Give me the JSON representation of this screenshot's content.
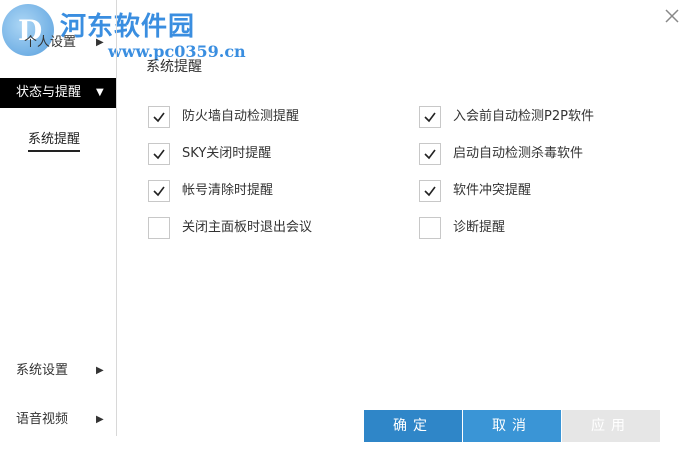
{
  "watermark": {
    "title": "河东软件园",
    "url": "www.pc0359.cn"
  },
  "sidebar": {
    "items": [
      {
        "label": "个人设置"
      },
      {
        "label": "状态与提醒"
      },
      {
        "label": "系统设置"
      },
      {
        "label": "语音视频"
      }
    ],
    "sub_items": [
      {
        "label": "系统提醒"
      }
    ]
  },
  "main": {
    "section_title": "系统提醒",
    "options_left": [
      {
        "label": "防火墙自动检测提醒",
        "checked": true
      },
      {
        "label": "SKY关闭时提醒",
        "checked": true
      },
      {
        "label": "帐号清除时提醒",
        "checked": true
      },
      {
        "label": "关闭主面板时退出会议",
        "checked": false
      }
    ],
    "options_right": [
      {
        "label": "入会前自动检测P2P软件",
        "checked": true
      },
      {
        "label": "启动自动检测杀毒软件",
        "checked": true
      },
      {
        "label": "软件冲突提醒",
        "checked": true
      },
      {
        "label": "诊断提醒",
        "checked": false
      }
    ]
  },
  "footer": {
    "ok_label": "确定",
    "cancel_label": "取消",
    "apply_label": "应用"
  },
  "colors": {
    "accent": "#2f86c8",
    "selected_nav_bg": "#000000",
    "disabled_btn": "#e6e6e6"
  }
}
